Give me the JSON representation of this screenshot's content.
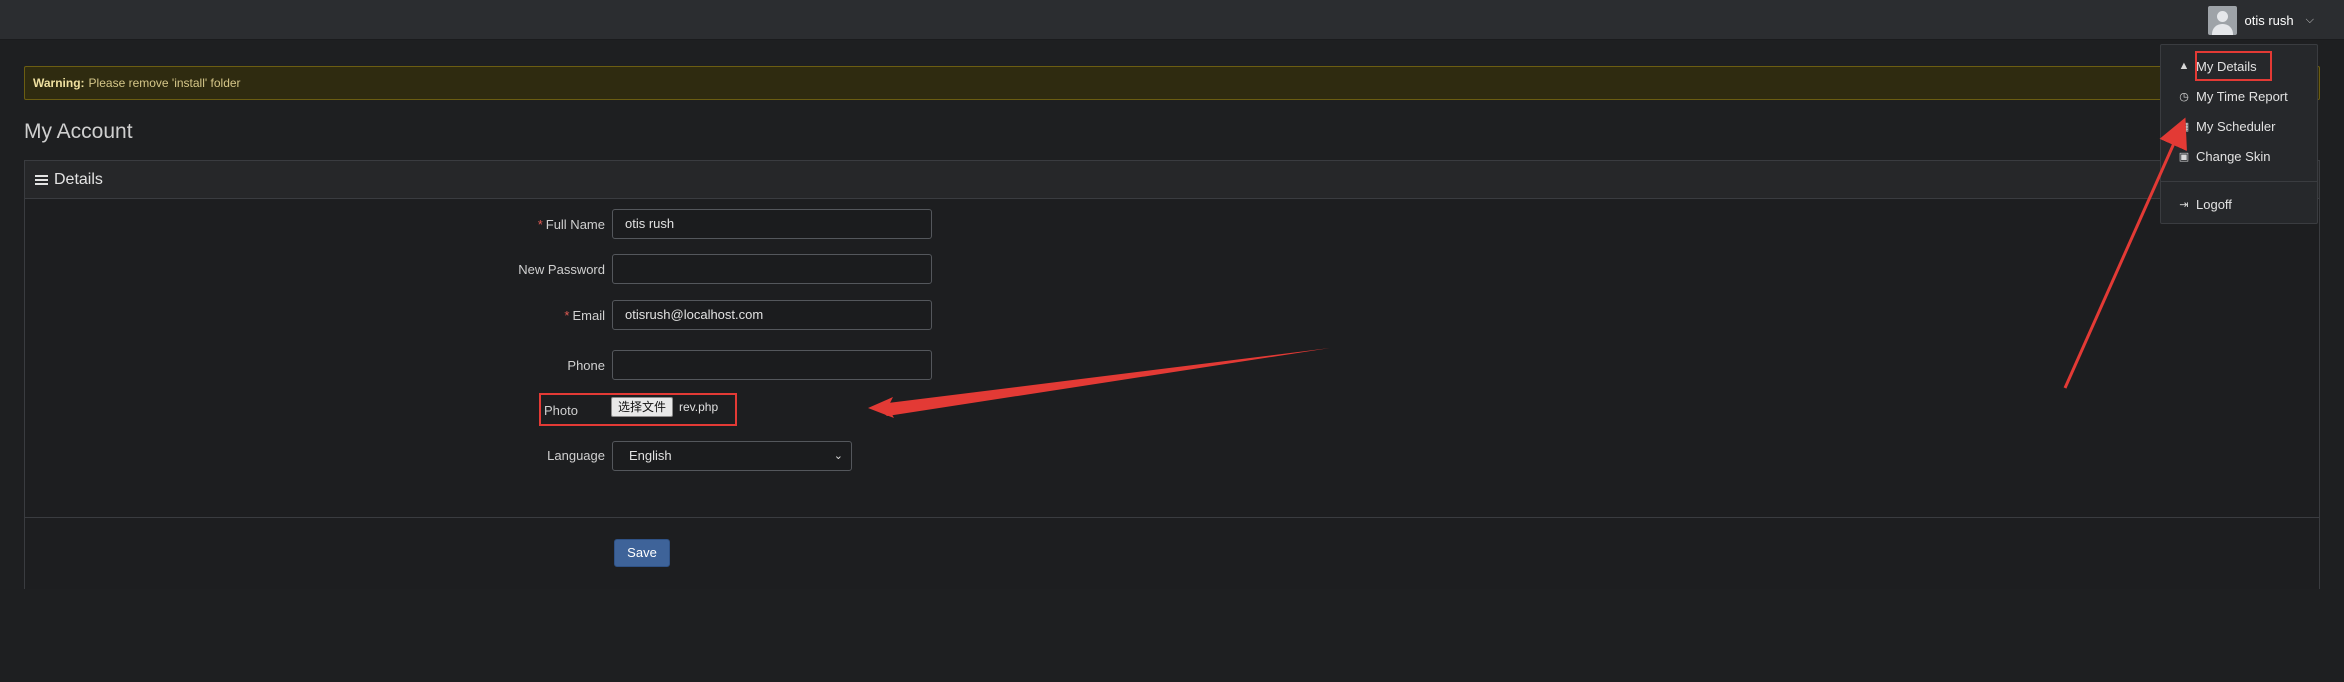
{
  "topbar": {
    "user_name": "otis rush"
  },
  "warning": {
    "label": "Warning:",
    "text": "Please remove 'install' folder"
  },
  "page_title": "My Account",
  "panel": {
    "title": "Details"
  },
  "form": {
    "full_name": {
      "label": "Full Name",
      "value": "otis rush",
      "required": true
    },
    "new_password": {
      "label": "New Password",
      "value": ""
    },
    "email": {
      "label": "Email",
      "value": "otisrush@localhost.com",
      "required": true
    },
    "phone": {
      "label": "Phone",
      "value": ""
    },
    "photo": {
      "label": "Photo",
      "button": "选择文件",
      "file": "rev.php"
    },
    "language": {
      "label": "Language",
      "selected": "English"
    },
    "save_label": "Save"
  },
  "user_dropdown": {
    "items": [
      {
        "label": "My Details",
        "icon": "user-icon"
      },
      {
        "label": "My Time Report",
        "icon": "clock-icon"
      },
      {
        "label": "My Scheduler",
        "icon": "calendar-icon"
      },
      {
        "label": "Change Skin",
        "icon": "image-icon"
      },
      {
        "label": "Logoff",
        "icon": "logoff-icon"
      }
    ]
  },
  "colors": {
    "highlight": "#e33a35",
    "save_button": "#3e6399",
    "warning_bg": "#2f2b10"
  }
}
